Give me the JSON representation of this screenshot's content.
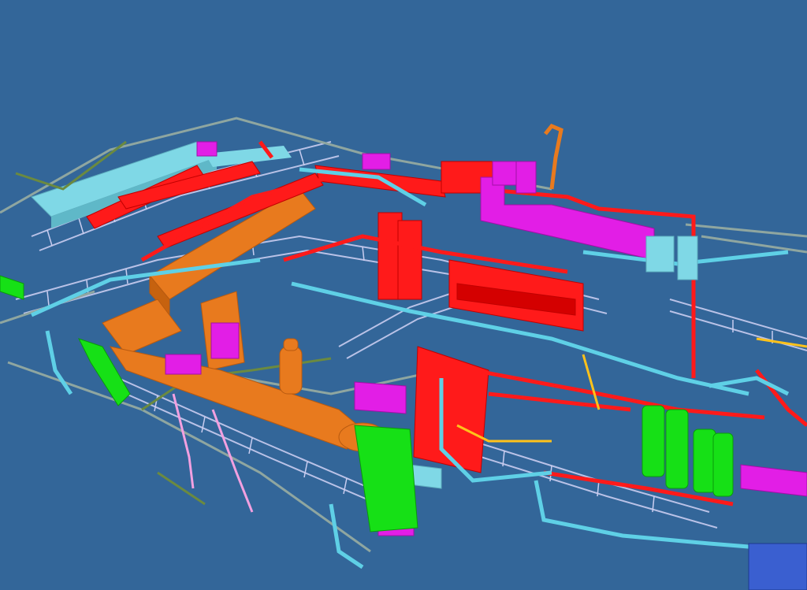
{
  "scene": {
    "description_free": true,
    "background_color": "#336699",
    "system_colors": {
      "supply_duct": "#ff1a1a",
      "return_duct": "#e87a1e",
      "exhaust_duct": "#e21ee6",
      "chilled_water": "#5fd0e6",
      "condenser_water": "#16e016",
      "cable_tray": "#c9cdf0",
      "gray_pipe": "#8fa6a0",
      "yellow_pipe": "#ffc21a",
      "pink_pipe": "#f2a0e0",
      "olive_pipe": "#6b8a40"
    }
  }
}
